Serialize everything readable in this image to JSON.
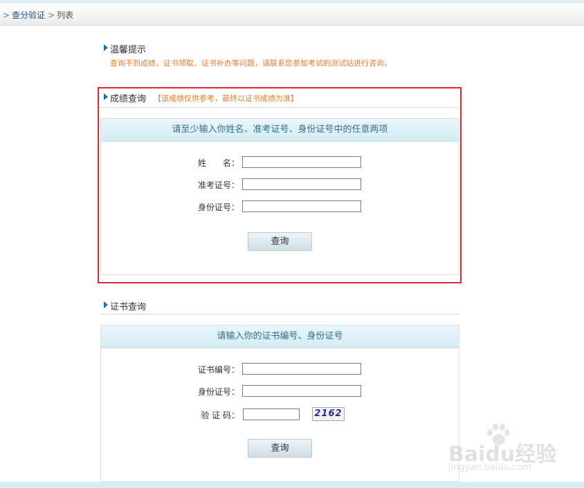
{
  "breadcrumb": {
    "sep1": ">",
    "link": "查分验证",
    "sep2": ">",
    "current": "列表"
  },
  "notice": {
    "title": "温馨提示",
    "text": "查询不到成绩、证书领取、证书补办等问题，请联系您参加考试的测试站进行咨询。"
  },
  "score_query": {
    "title": "成绩查询",
    "note": "【该成绩仅供参考，最终以证书成绩为准】",
    "panel_heading": "请至少输入你姓名、准考证号、身份证号中的任意两项",
    "fields": [
      {
        "label": "姓　　名：",
        "value": ""
      },
      {
        "label": "准考证号：",
        "value": ""
      },
      {
        "label": "身份证号：",
        "value": ""
      }
    ],
    "submit_label": "查询"
  },
  "cert_query": {
    "title": "证书查询",
    "panel_heading": "请输入你的证书编号、身份证号",
    "fields": [
      {
        "label": "证书编号：",
        "value": ""
      },
      {
        "label": "身份证号：",
        "value": ""
      },
      {
        "label": "验 证 码：",
        "value": ""
      }
    ],
    "captcha_text": "2162",
    "submit_label": "查询"
  },
  "watermark": {
    "brand": "Baidu经验",
    "url": "jingyan.baidu.com"
  },
  "colors": {
    "accent_orange": "#ec7b2c",
    "heading_blue": "#2f6f8b",
    "highlight_red": "#e0232c"
  }
}
